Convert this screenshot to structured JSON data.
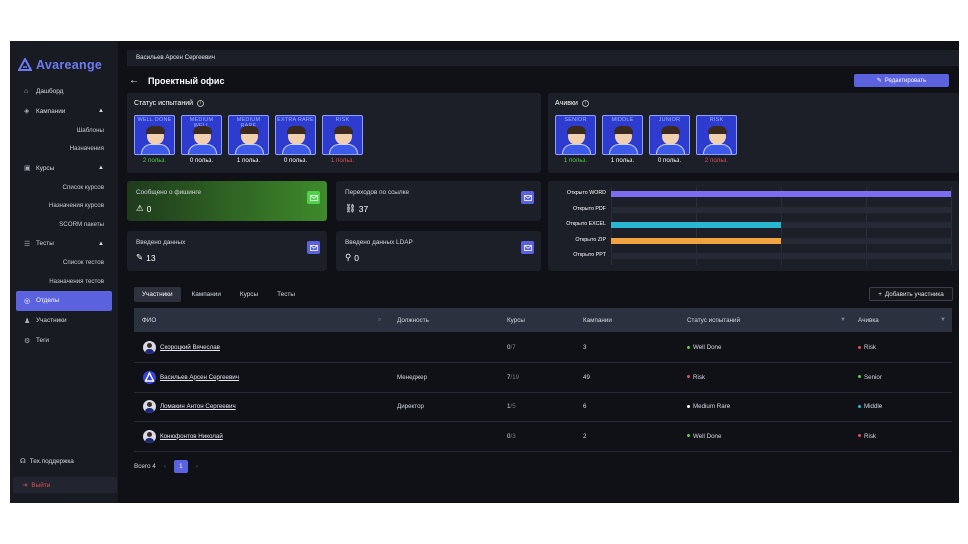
{
  "brand": {
    "name": "Avareange",
    "accent": "#5b62dd"
  },
  "sidebar": {
    "items": [
      {
        "label": "Дашборд",
        "icon": "home-icon"
      },
      {
        "label": "Кампании",
        "icon": "campaign-icon",
        "sub": [
          "Шаблоны",
          "Назначения"
        ]
      },
      {
        "label": "Курсы",
        "icon": "course-icon",
        "sub": [
          "Список курсов",
          "Назначения курсов",
          "SCORM пакеты"
        ]
      },
      {
        "label": "Тесты",
        "icon": "test-icon",
        "sub": [
          "Список тестов",
          "Назначения тестов"
        ]
      },
      {
        "label": "Отделы",
        "icon": "department-icon"
      },
      {
        "label": "Участники",
        "icon": "users-icon"
      },
      {
        "label": "Теги",
        "icon": "tag-icon"
      }
    ],
    "support": "Тех.поддержка",
    "exit": "Выйти"
  },
  "header": {
    "user": "Васильев Арсен Сергеевич",
    "title": "Проектный офис",
    "edit": "Редактировать"
  },
  "test_status": {
    "title": "Статус испытаний",
    "badges": [
      {
        "label": "WELL DONE",
        "count": "2 польз.",
        "color": "#4fd24a"
      },
      {
        "label": "MEDIUM WELL",
        "count": "0 польз.",
        "color": "#ffffff"
      },
      {
        "label": "MEDIUM RARE",
        "count": "1 польз.",
        "color": "#ffffff"
      },
      {
        "label": "EXTRA RARE",
        "count": "0 польз.",
        "color": "#ffffff"
      },
      {
        "label": "RISK",
        "count": "1 польз.",
        "color": "#e0505a"
      }
    ]
  },
  "achievements": {
    "title": "Ачивки",
    "badges": [
      {
        "label": "SENIOR",
        "count": "1 польз.",
        "color": "#4fd24a"
      },
      {
        "label": "MIDDLE",
        "count": "1 польз.",
        "color": "#ffffff"
      },
      {
        "label": "JUNIOR",
        "count": "0 польз.",
        "color": "#ffffff"
      },
      {
        "label": "RISK",
        "count": "2 польз.",
        "color": "#e0505a"
      }
    ]
  },
  "metrics": [
    {
      "label": "Сообщено о фишинге",
      "value": "0",
      "icon": "warning-icon"
    },
    {
      "label": "Переходов по ссылке",
      "value": "37",
      "icon": "link-icon"
    },
    {
      "label": "Введено данных",
      "value": "13",
      "icon": "edit-icon"
    },
    {
      "label": "Введено данных LDAP",
      "value": "0",
      "icon": "network-icon"
    }
  ],
  "chart_data": {
    "type": "bar",
    "orientation": "horizontal",
    "categories": [
      "Открыто WORD",
      "Открыто PDF",
      "Открыто EXCEL",
      "Открыто ZIP",
      "Открыто PPT"
    ],
    "values": [
      1.0,
      0,
      0.5,
      0.5,
      0
    ],
    "colors": [
      "#7b6cf0",
      "#7b6cf0",
      "#2ab7d0",
      "#f0a340",
      "#7b6cf0"
    ],
    "grid": true
  },
  "tabs": [
    "Участники",
    "Кампании",
    "Курсы",
    "Тесты"
  ],
  "add_participant": "Добавить участника",
  "table": {
    "headers": [
      "ФИО",
      "Должность",
      "Курсы",
      "Кампании",
      "Статус испытаний",
      "Ачивка"
    ],
    "rows": [
      {
        "name": "Скороцкий Вячеслав",
        "position": "",
        "courses": "0",
        "courses_total": "7",
        "campaigns": "3",
        "status": "Well Done",
        "status_color": "#4fd24a",
        "ach": "Risk",
        "ach_color": "#e0505a",
        "avatar": "person"
      },
      {
        "name": "Васильев Арсен Сергеевич",
        "position": "Менеджер",
        "courses": "7",
        "courses_total": "19",
        "campaigns": "49",
        "status": "Risk",
        "status_color": "#e0505a",
        "ach": "Senior",
        "ach_color": "#4fd24a",
        "avatar": "logo"
      },
      {
        "name": "Ломакин Антон Сергеевич",
        "position": "Директор",
        "courses": "1",
        "courses_total": "5",
        "campaigns": "6",
        "status": "Medium Rare",
        "status_color": "#ffffff",
        "ach": "Middle",
        "ach_color": "#2ab7d0",
        "avatar": "person"
      },
      {
        "name": "Конюфонтов Николай",
        "position": "",
        "courses": "0",
        "courses_total": "3",
        "campaigns": "2",
        "status": "Well Done",
        "status_color": "#4fd24a",
        "ach": "Risk",
        "ach_color": "#e0505a",
        "avatar": "person"
      }
    ]
  },
  "pagination": {
    "total": "Всего 4",
    "page": "1"
  }
}
